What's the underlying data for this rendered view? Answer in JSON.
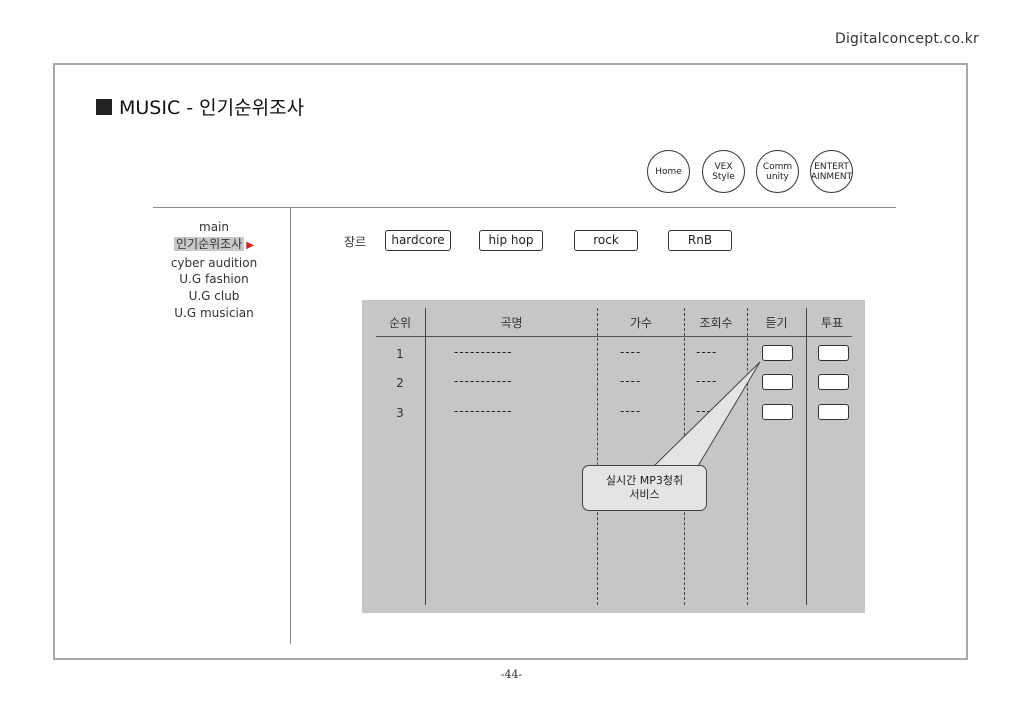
{
  "site": "Digitalconcept.co.kr",
  "title": "MUSIC - 인기순위조사",
  "nav_circles": [
    {
      "label": "Home"
    },
    {
      "label": "VEX\nStyle"
    },
    {
      "label": "Comm\nunity"
    },
    {
      "label": "ENTERT\nAINMENT"
    }
  ],
  "sidebar": {
    "items": [
      "main",
      "인기순위조사",
      "cyber audition",
      "U.G fashion",
      "U.G club",
      "U.G musician"
    ],
    "active_index": 1,
    "active_marker": "▶"
  },
  "genre": {
    "label": "장르",
    "buttons": [
      "hardcore",
      "hip hop",
      "rock",
      "RnB"
    ]
  },
  "table": {
    "headers": [
      "순위",
      "곡명",
      "가수",
      "조회수",
      "듣기",
      "투표"
    ],
    "rows": [
      {
        "rank": "1",
        "song": "-----------",
        "artist": "----",
        "views": "----"
      },
      {
        "rank": "2",
        "song": "-----------",
        "artist": "----",
        "views": "----"
      },
      {
        "rank": "3",
        "song": "-----------",
        "artist": "----",
        "views": "----"
      }
    ]
  },
  "callout": {
    "text": "실시간 MP3청취\n서비스"
  },
  "page_number": "-44-",
  "colors": {
    "frame": "#a8a8a8",
    "table_bg": "#c6c6c6",
    "active_marker": "#d32020",
    "callout_bg": "#e4e4e4"
  }
}
